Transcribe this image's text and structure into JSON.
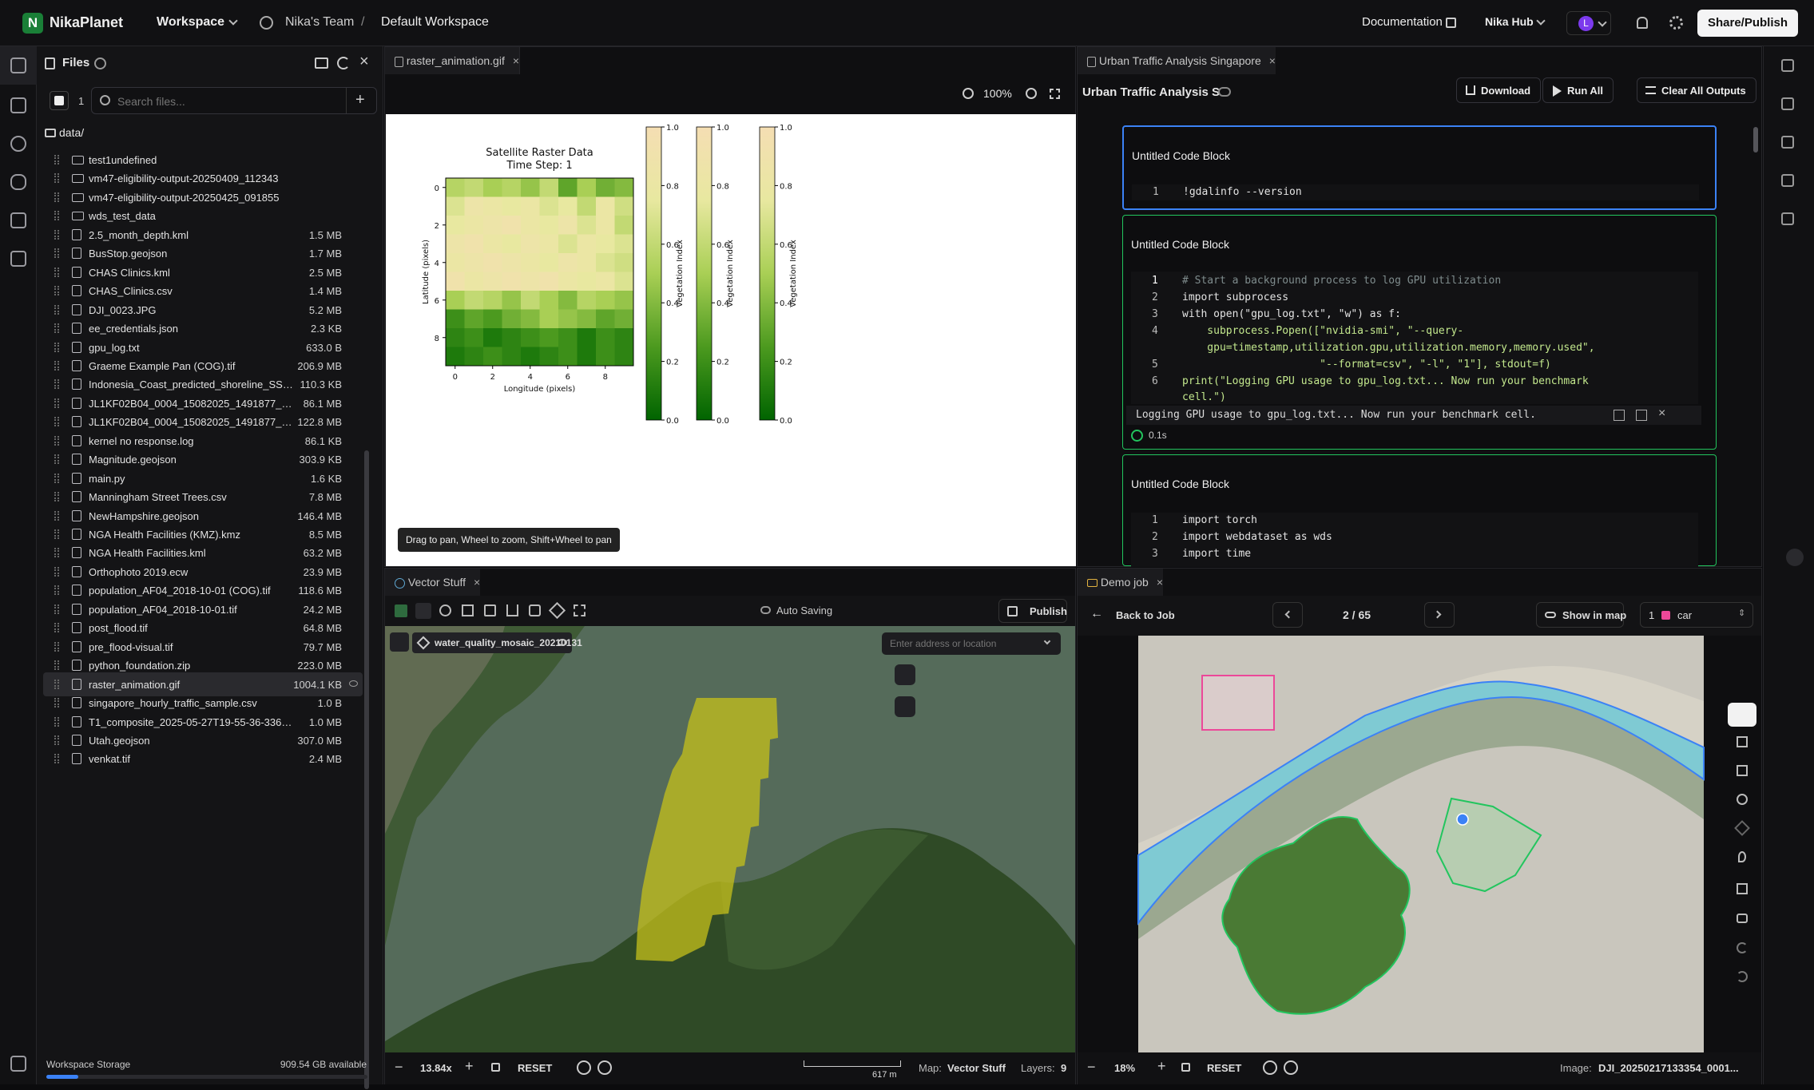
{
  "app": {
    "name": "NikaPlanet",
    "workspace_menu": "Workspace",
    "team": "Nika's Team",
    "separator": "/",
    "workspace_name": "Default Workspace",
    "documentation": "Documentation",
    "hub": "Nika Hub",
    "avatar_letter": "L",
    "share_button": "Share/Publish"
  },
  "files": {
    "title": "Files",
    "selected_count": "1",
    "search_placeholder": "Search files...",
    "path": "data/",
    "items": [
      {
        "name": "test1undefined",
        "size": "",
        "type": "folder"
      },
      {
        "name": "vm47-eligibility-output-20250409_112343",
        "size": "",
        "type": "folder"
      },
      {
        "name": "vm47-eligibility-output-20250425_091855",
        "size": "",
        "type": "folder"
      },
      {
        "name": "wds_test_data",
        "size": "",
        "type": "folder"
      },
      {
        "name": "2.5_month_depth.kml",
        "size": "1.5 MB",
        "type": "file"
      },
      {
        "name": "BusStop.geojson",
        "size": "1.7 MB",
        "type": "file"
      },
      {
        "name": "CHAS Clinics.kml",
        "size": "2.5 MB",
        "type": "file"
      },
      {
        "name": "CHAS_Clinics.csv",
        "size": "1.4 MB",
        "type": "file"
      },
      {
        "name": "DJI_0023.JPG",
        "size": "5.2 MB",
        "type": "file"
      },
      {
        "name": "ee_credentials.json",
        "size": "2.3 KB",
        "type": "file"
      },
      {
        "name": "gpu_log.txt",
        "size": "633.0 B",
        "type": "file"
      },
      {
        "name": "Graeme Example Pan (COG).tif",
        "size": "206.9 MB",
        "type": "file"
      },
      {
        "name": "Indonesia_Coast_predicted_shoreline_SSP...",
        "size": "110.3 KB",
        "type": "file"
      },
      {
        "name": "JL1KF02B04_0004_15082025_1491877_MS...",
        "size": "86.1 MB",
        "type": "file"
      },
      {
        "name": "JL1KF02B04_0004_15082025_1491877_M...",
        "size": "122.8 MB",
        "type": "file"
      },
      {
        "name": "kernel no response.log",
        "size": "86.1 KB",
        "type": "file"
      },
      {
        "name": "Magnitude.geojson",
        "size": "303.9 KB",
        "type": "file"
      },
      {
        "name": "main.py",
        "size": "1.6 KB",
        "type": "file"
      },
      {
        "name": "Manningham Street Trees.csv",
        "size": "7.8 MB",
        "type": "file"
      },
      {
        "name": "NewHampshire.geojson",
        "size": "146.4 MB",
        "type": "file"
      },
      {
        "name": "NGA Health Facilities (KMZ).kmz",
        "size": "8.5 MB",
        "type": "file"
      },
      {
        "name": "NGA Health Facilities.kml",
        "size": "63.2 MB",
        "type": "file"
      },
      {
        "name": "Orthophoto 2019.ecw",
        "size": "23.9 MB",
        "type": "file"
      },
      {
        "name": "population_AF04_2018-10-01 (COG).tif",
        "size": "118.6 MB",
        "type": "file"
      },
      {
        "name": "population_AF04_2018-10-01.tif",
        "size": "24.2 MB",
        "type": "file"
      },
      {
        "name": "post_flood.tif",
        "size": "64.8 MB",
        "type": "file"
      },
      {
        "name": "pre_flood-visual.tif",
        "size": "79.7 MB",
        "type": "file"
      },
      {
        "name": "python_foundation.zip",
        "size": "223.0 MB",
        "type": "file"
      },
      {
        "name": "raster_animation.gif",
        "size": "1004.1 KB",
        "type": "file",
        "selected": true
      },
      {
        "name": "singapore_hourly_traffic_sample.csv",
        "size": "1.0 B",
        "type": "file"
      },
      {
        "name": "T1_composite_2025-05-27T19-55-36-336Z.tif",
        "size": "1.0 MB",
        "type": "file"
      },
      {
        "name": "Utah.geojson",
        "size": "307.0 MB",
        "type": "file"
      },
      {
        "name": "venkat.tif",
        "size": "2.4 MB",
        "type": "file"
      }
    ],
    "storage_label": "Workspace Storage",
    "storage_value": "909.54 GB available",
    "storage_fill": 0.1
  },
  "gif_pane": {
    "tab": "raster_animation.gif",
    "zoom": "100%",
    "hint": "Drag to pan, Wheel to zoom, Shift+Wheel to pan"
  },
  "chart_data": {
    "type": "heatmap",
    "title": "Satellite Raster Data",
    "subtitle": "Time Step: 1",
    "xlabel": "Longitude (pixels)",
    "ylabel": "Latitude (pixels)",
    "xticks": [
      "0",
      "2",
      "4",
      "6",
      "8"
    ],
    "yticks": [
      "0",
      "2",
      "4",
      "6",
      "8"
    ],
    "colorbar_label": "Vegetation Index",
    "colorbar_ticks": [
      "0.0",
      "0.2",
      "0.4",
      "0.6",
      "0.8",
      "1.0"
    ],
    "colorbar_count": 3,
    "colormap": [
      "#006400",
      "#4c9a1f",
      "#a9cf55",
      "#e8e8a0",
      "#f5deb3"
    ],
    "values": [
      [
        0.55,
        0.6,
        0.5,
        0.55,
        0.45,
        0.6,
        0.3,
        0.5,
        0.35,
        0.4
      ],
      [
        0.7,
        0.85,
        0.8,
        0.75,
        0.8,
        0.7,
        0.75,
        0.6,
        0.8,
        0.65
      ],
      [
        0.75,
        0.8,
        0.85,
        0.9,
        0.8,
        0.75,
        0.85,
        0.7,
        0.8,
        0.6
      ],
      [
        0.85,
        0.9,
        0.8,
        0.75,
        0.85,
        0.8,
        0.7,
        0.8,
        0.75,
        0.7
      ],
      [
        0.8,
        0.85,
        0.9,
        0.85,
        0.8,
        0.75,
        0.85,
        0.8,
        0.7,
        0.65
      ],
      [
        0.9,
        0.8,
        0.85,
        0.9,
        0.85,
        0.9,
        0.8,
        0.75,
        0.8,
        0.7
      ],
      [
        0.5,
        0.6,
        0.55,
        0.45,
        0.6,
        0.5,
        0.4,
        0.55,
        0.5,
        0.45
      ],
      [
        0.2,
        0.3,
        0.25,
        0.35,
        0.4,
        0.5,
        0.45,
        0.4,
        0.3,
        0.35
      ],
      [
        0.15,
        0.2,
        0.1,
        0.15,
        0.2,
        0.25,
        0.2,
        0.1,
        0.2,
        0.15
      ],
      [
        0.1,
        0.15,
        0.2,
        0.15,
        0.1,
        0.15,
        0.2,
        0.1,
        0.2,
        0.15
      ]
    ]
  },
  "notebook": {
    "tab": "Urban Traffic Analysis Singapore",
    "title": "Urban Traffic Analysis S",
    "download": "Download",
    "run_all": "Run All",
    "clear_outputs": "Clear All Outputs",
    "cells": [
      {
        "title": "Untitled Code Block",
        "lines": [
          "!gdalinfo --version"
        ]
      },
      {
        "title": "Untitled Code Block",
        "lines": [
          "# Start a background process to log GPU utilization",
          "import subprocess",
          "with open(\"gpu_log.txt\", \"w\") as f:",
          "    subprocess.Popen([\"nvidia-smi\", \"--query-",
          "    gpu=timestamp,utilization.gpu,utilization.memory,memory.used\",",
          "                      \"--format=csv\", \"-l\", \"1\"], stdout=f)",
          "print(\"Logging GPU usage to gpu_log.txt... Now run your benchmark",
          "cell.\")"
        ],
        "line_numbers": [
          "1",
          "2",
          "3",
          "4",
          "",
          "5",
          "6",
          ""
        ],
        "output": "Logging GPU usage to gpu_log.txt... Now run your benchmark cell.",
        "time": "0.1s"
      },
      {
        "title": "Untitled Code Block",
        "lines": [
          "import torch",
          "import webdataset as wds",
          "import time"
        ]
      }
    ]
  },
  "vector_pane": {
    "tab": "Vector Stuff",
    "auto_saving": "Auto Saving",
    "publish": "Publish",
    "layer_name": "water_quality_mosaic_20210131",
    "address_placeholder": "Enter address or location",
    "zoom": "13.84x",
    "reset": "RESET",
    "scale": "617 m",
    "map_label": "Map:",
    "map_name": "Vector Stuff",
    "layers_label": "Layers:",
    "layers_count": "9"
  },
  "demo_pane": {
    "tab": "Demo job",
    "back": "Back to Job",
    "page": "2 / 65",
    "show_in_map": "Show in map",
    "class_index": "1",
    "class_name": "car",
    "class_color": "#ec4899",
    "zoom": "18%",
    "reset": "RESET",
    "image_label": "Image:",
    "image_name": "DJI_20250217133354_0001..."
  }
}
